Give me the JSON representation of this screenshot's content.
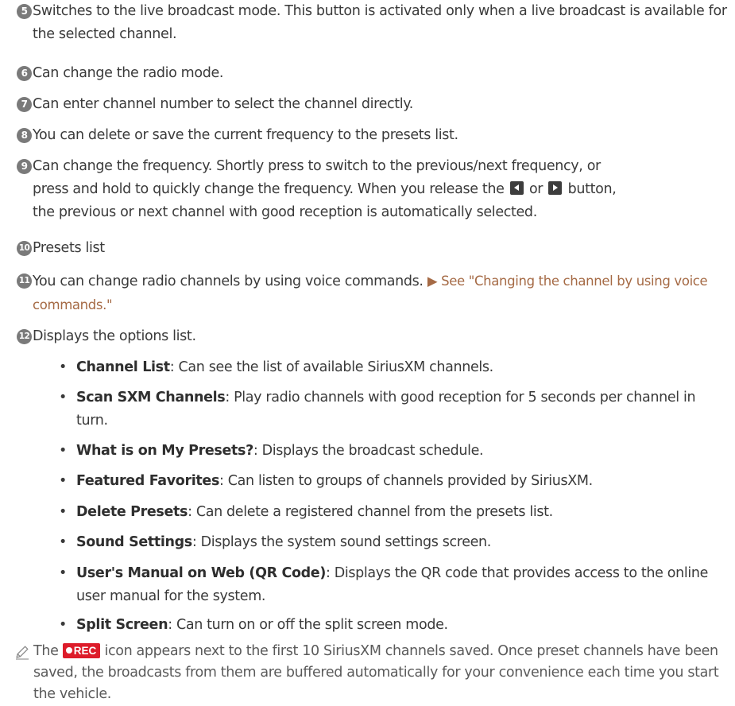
{
  "items": [
    {
      "num": "5",
      "lines": [
        "Switches to the live broadcast mode. This button is activated only when a live broadcast is available for the selected channel."
      ]
    },
    {
      "num": "6",
      "lines": [
        "Can change the radio mode."
      ]
    },
    {
      "num": "7",
      "lines": [
        "Can enter channel number to select the channel directly."
      ]
    },
    {
      "num": "8",
      "lines": [
        "You can delete or save the current frequency to the presets list."
      ]
    },
    {
      "num": "9",
      "line1": "Can change the frequency. Shortly press to switch to the previous/next frequency, or",
      "line2_pre": "press and hold to quickly change the frequency. When you release the",
      "line2_mid": "or",
      "line2_post": "button,",
      "line3": "the previous or next channel with good reception is automatically selected."
    },
    {
      "num": "10",
      "lines": [
        "Presets list"
      ]
    },
    {
      "num": "11",
      "text": "You can change radio channels by using voice commands.",
      "xref": "▶ See \"Changing the channel by using voice commands.\""
    },
    {
      "num": "12",
      "lines": [
        "Displays the options list."
      ]
    }
  ],
  "options": [
    {
      "term": "Channel List",
      "desc": ": Can see the list of available SiriusXM channels."
    },
    {
      "term": "Scan SXM Channels",
      "desc": ": Play radio channels with good reception for 5 seconds per channel in turn."
    },
    {
      "term": "What is on My Presets?",
      "desc": ": Displays the broadcast schedule."
    },
    {
      "term": "Featured Favorites",
      "desc": ": Can listen to groups of channels provided by SiriusXM."
    },
    {
      "term": "Delete Presets",
      "desc": ": Can delete a registered channel from the presets list."
    },
    {
      "term": "Sound Settings",
      "desc": ": Displays the system sound settings screen."
    },
    {
      "term": "User's Manual on Web (QR Code)",
      "desc": ": Displays the QR code that provides access to the online user manual for the system."
    },
    {
      "term": "Split Screen",
      "desc": ": Can turn on or off the split screen mode."
    }
  ],
  "note": {
    "pre": "The",
    "badge": "REC",
    "post": "icon appears next to the first 10 SiriusXM channels saved. Once preset channels have been saved, the broadcasts from them are buffered automatically for your convenience each time you start the vehicle."
  },
  "icons": {
    "note": "pencil-note-icon",
    "prev": "seek-prev-icon",
    "next": "seek-next-icon",
    "rec": "rec-badge-icon"
  },
  "colors": {
    "text": "#3a3a3a",
    "number_circle": "#7a7a7a",
    "xref": "#a56a45",
    "rec_badge": "#dd1c2a"
  }
}
